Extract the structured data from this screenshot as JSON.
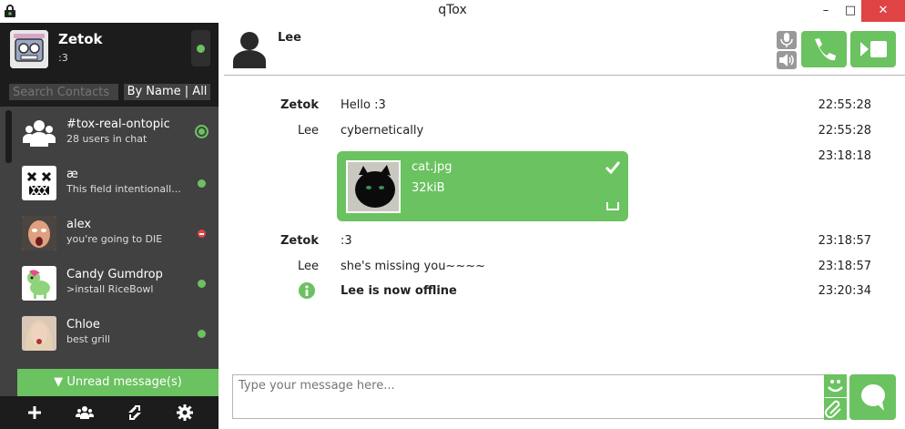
{
  "window": {
    "title": "qTox",
    "minimize": "–",
    "maximize": "□",
    "close": "✕"
  },
  "profile": {
    "name": "Zetok",
    "status_message": ":3",
    "status": "online"
  },
  "search": {
    "placeholder": "Search Contacts",
    "sort_label": "By Name | All"
  },
  "contacts": [
    {
      "name": "#tox-real-ontopic",
      "message": "28 users in chat",
      "status": "online",
      "type": "group"
    },
    {
      "name": "æ",
      "message": "This field intentionall...",
      "status": "online"
    },
    {
      "name": "alex",
      "message": "you're going to DIE",
      "status": "busy"
    },
    {
      "name": "Candy Gumdrop",
      "message": ">install RiceBowl",
      "status": "online"
    },
    {
      "name": "Chloe",
      "message": "best grill",
      "status": "online"
    }
  ],
  "unread_button": "Unread message(s)",
  "chat": {
    "contact_name": "Lee",
    "messages": [
      {
        "author": "Zetok",
        "author_bold": true,
        "text": "Hello :3",
        "time": "22:55:28"
      },
      {
        "author": "Lee",
        "author_bold": false,
        "text": "cybernetically",
        "time": "22:55:28"
      },
      {
        "author": "",
        "text": "",
        "time": "23:18:18"
      },
      {
        "author": "Zetok",
        "author_bold": true,
        "text": ":3",
        "time": "23:18:57"
      },
      {
        "author": "Lee",
        "author_bold": false,
        "text": "she's missing you~~~~",
        "time": "23:18:57"
      },
      {
        "author": "",
        "text": "Lee is now offline",
        "time": "23:20:34",
        "system": true
      }
    ],
    "file_transfer": {
      "filename": "cat.jpg",
      "size": "32kiB"
    },
    "input_placeholder": "Type your message here..."
  },
  "colors": {
    "accent": "#6bc260",
    "sidebar_dark": "#1c1c1c",
    "sidebar": "#414141",
    "busy": "#e04343"
  }
}
